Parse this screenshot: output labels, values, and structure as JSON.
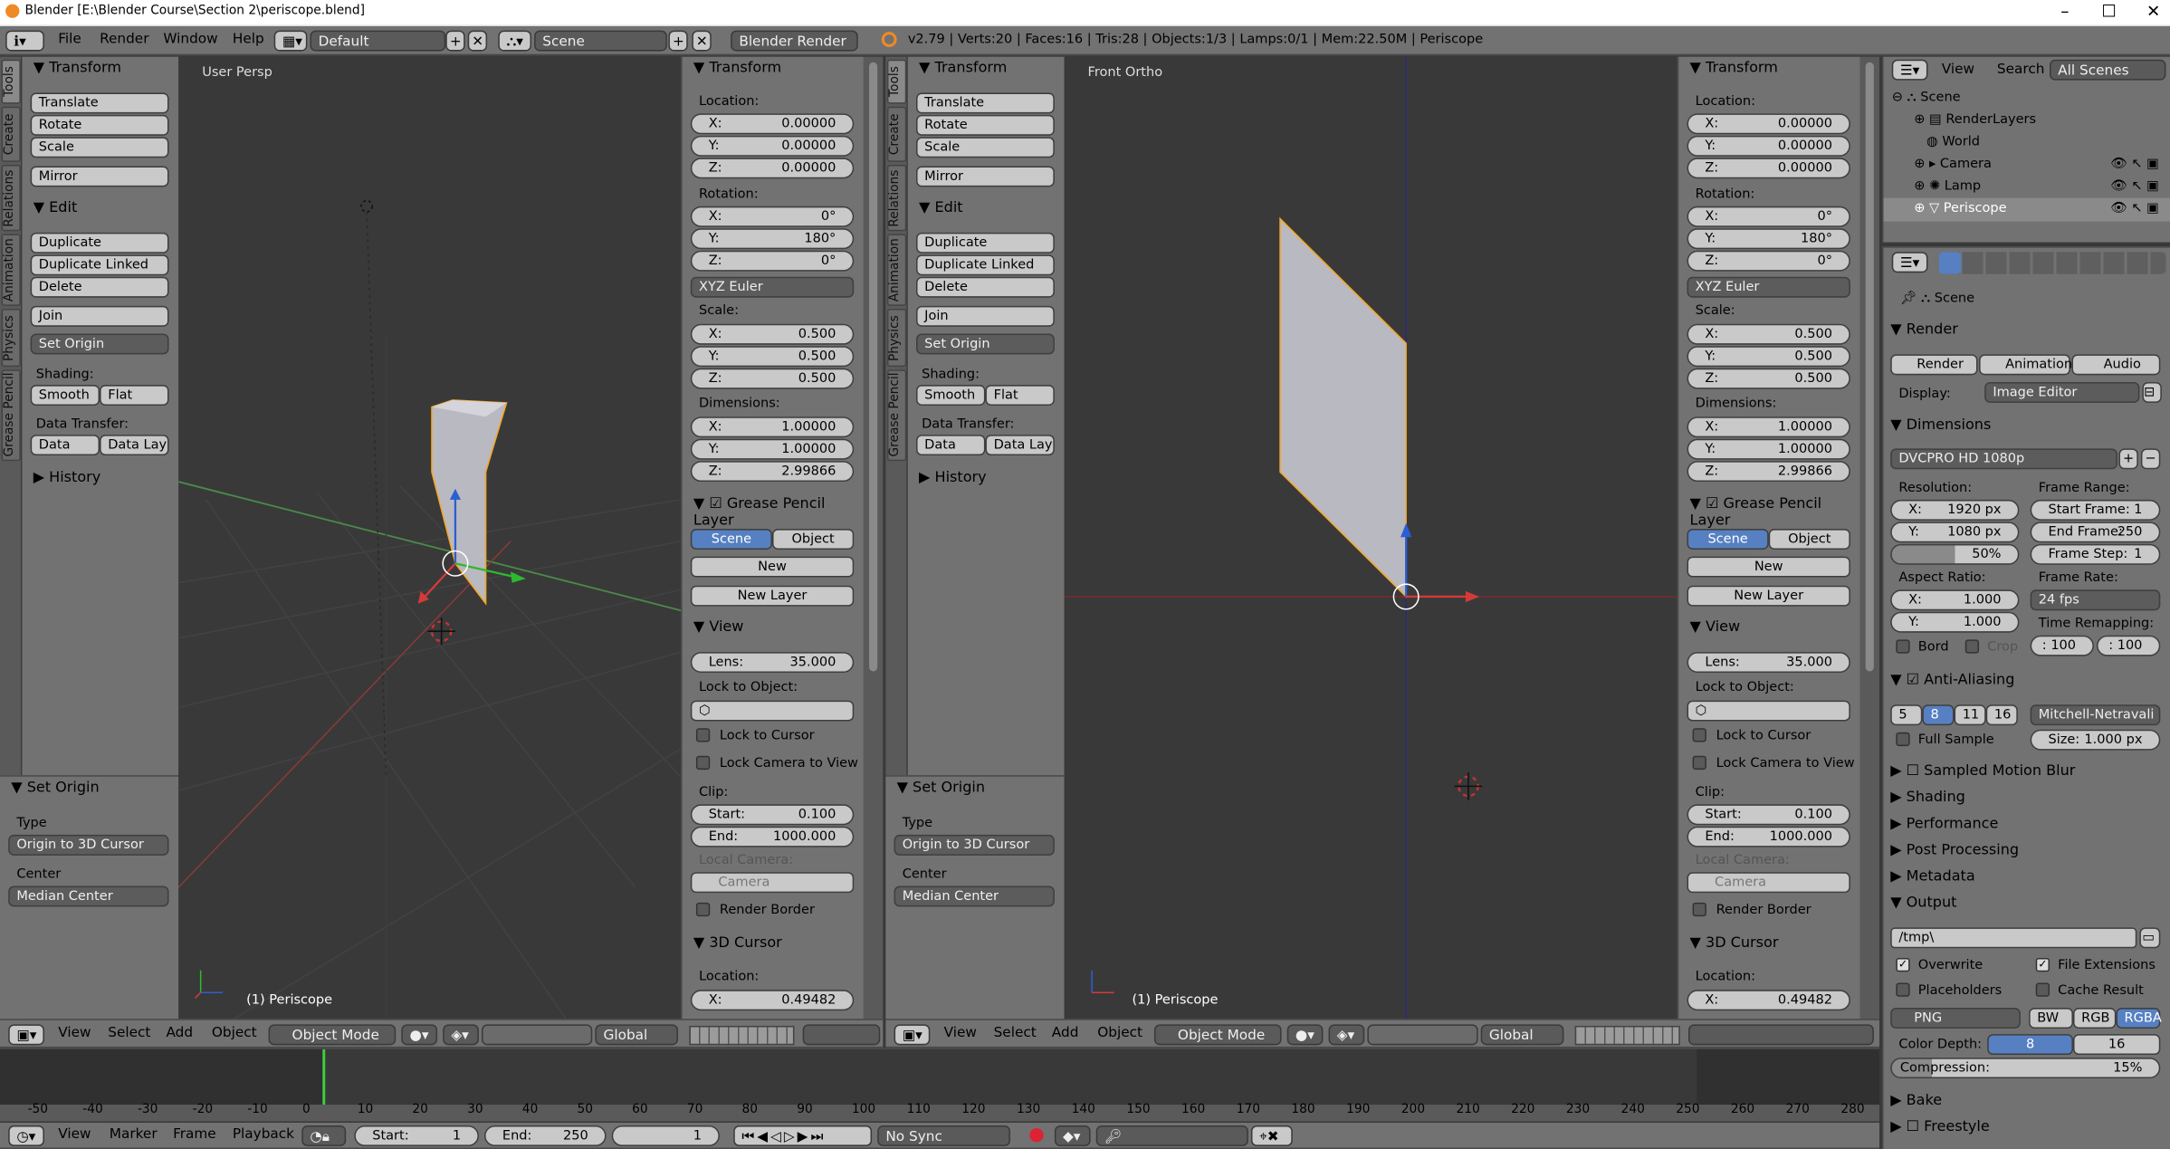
{
  "window": {
    "title": "Blender [E:\\Blender Course\\Section 2\\periscope.blend]",
    "minimize": "–",
    "maximize": "☐",
    "close": "✕"
  },
  "top_bar": {
    "menus": [
      "File",
      "Render",
      "Window",
      "Help"
    ],
    "layout": "Default",
    "scene": "Scene",
    "engine": "Blender Render",
    "stats": "v2.79 | Verts:20 | Faces:16 | Tris:28 | Objects:1/3 | Lamps:0/1 | Mem:22.50M | Periscope"
  },
  "tool_tabs": [
    "Tools",
    "Create",
    "Relations",
    "Animation",
    "Physics",
    "Grease Pencil"
  ],
  "tool_shelf": {
    "transform_header": "Transform",
    "translate": "Translate",
    "rotate": "Rotate",
    "scale": "Scale",
    "mirror": "Mirror",
    "edit_header": "Edit",
    "duplicate": "Duplicate",
    "duplicate_linked": "Duplicate Linked",
    "delete": "Delete",
    "join": "Join",
    "set_origin": "Set Origin",
    "shading_label": "Shading:",
    "smooth": "Smooth",
    "flat": "Flat",
    "data_transfer_label": "Data Transfer:",
    "data": "Data",
    "data_lay": "Data Lay",
    "history": "History"
  },
  "operator_panel": {
    "header": "Set Origin",
    "type_label": "Type",
    "type_value": "Origin to 3D Cursor",
    "center_label": "Center",
    "center_value": "Median Center"
  },
  "viewport_left": {
    "label": "User Persp",
    "object_label": "(1) Periscope"
  },
  "viewport_right": {
    "label": "Front Ortho",
    "object_label": "(1) Periscope"
  },
  "n_panel": {
    "transform": "Transform",
    "location_label": "Location:",
    "loc": [
      "0.00000",
      "0.00000",
      "0.00000"
    ],
    "rotation_label": "Rotation:",
    "rot": [
      "0°",
      "180°",
      "0°"
    ],
    "rot_mode": "XYZ Euler",
    "scale_label": "Scale:",
    "scale": [
      "0.500",
      "0.500",
      "0.500"
    ],
    "dimensions_label": "Dimensions:",
    "dim": [
      "1.00000",
      "1.00000",
      "2.99866"
    ],
    "axes": [
      "X:",
      "Y:",
      "Z:"
    ],
    "gp_layer": "Grease Pencil Layer",
    "scene_btn": "Scene",
    "object_btn": "Object",
    "new_btn": "New",
    "new_layer": "New Layer",
    "view_header": "View",
    "lens_label": "Lens:",
    "lens_value": "35.000",
    "lock_obj_label": "Lock to Object:",
    "lock_cursor": "Lock to Cursor",
    "lock_camera": "Lock Camera to View",
    "clip_label": "Clip:",
    "clip_start_label": "Start:",
    "clip_start": "0.100",
    "clip_end_label": "End:",
    "clip_end": "1000.000",
    "local_camera": "Local Camera:",
    "camera": "Camera",
    "render_border": "Render Border",
    "cursor_header": "3D Cursor",
    "cursor_loc_label": "Location:",
    "cursor_x": "0.49482"
  },
  "viewport_header": {
    "menus": [
      "View",
      "Select",
      "Add",
      "Object"
    ],
    "mode": "Object Mode",
    "orientation": "Global"
  },
  "outliner": {
    "view": "View",
    "search": "Search",
    "filter": "All Scenes",
    "items": [
      "Scene",
      "RenderLayers",
      "World",
      "Camera",
      "Lamp",
      "Periscope"
    ]
  },
  "properties": {
    "scene_label": "Scene",
    "render_header": "Render",
    "render_btn": "Render",
    "animation_btn": "Animation",
    "audio_btn": "Audio",
    "display_label": "Display:",
    "display_value": "Image Editor",
    "dimensions_header": "Dimensions",
    "preset": "DVCPRO HD 1080p",
    "resolution_label": "Resolution:",
    "res_x": "1920 px",
    "res_y": "1080 px",
    "res_pct": "50%",
    "frame_range_label": "Frame Range:",
    "start_frame_label": "Start Frame:",
    "start_frame": "1",
    "end_frame_label": "End Frame:",
    "end_frame": "250",
    "frame_step_label": "Frame Step:",
    "frame_step": "1",
    "aspect_label": "Aspect Ratio:",
    "aspect_x": "1.000",
    "aspect_y": "1.000",
    "frame_rate_label": "Frame Rate:",
    "frame_rate": "24 fps",
    "bord": "Bord",
    "crop": "Crop",
    "time_remap_label": "Time Remapping:",
    "remap_old": ": 100",
    "remap_new": ": 100",
    "aa_header": "Anti-Aliasing",
    "aa_samples": [
      "5",
      "8",
      "11",
      "16"
    ],
    "aa_filter": "Mitchell-Netravali",
    "full_sample": "Full Sample",
    "size_label": "Size:",
    "size_value": "1.000 px",
    "collapsed": [
      "Sampled Motion Blur",
      "Shading",
      "Performance",
      "Post Processing",
      "Metadata"
    ],
    "output_header": "Output",
    "output_path": "/tmp\\",
    "overwrite": "Overwrite",
    "file_ext": "File Extensions",
    "placeholders": "Placeholders",
    "cache_result": "Cache Result",
    "format": "PNG",
    "bw": "BW",
    "rgb": "RGB",
    "rgba": "RGBA",
    "color_depth_label": "Color Depth:",
    "depth_8": "8",
    "depth_16": "16",
    "compression_label": "Compression:",
    "compression_value": "15%",
    "bake": "Bake",
    "freestyle": "Freestyle"
  },
  "timeline": {
    "ticks": [
      "-50",
      "-40",
      "-30",
      "-20",
      "-10",
      "0",
      "10",
      "20",
      "30",
      "40",
      "50",
      "60",
      "70",
      "80",
      "90",
      "100",
      "110",
      "120",
      "130",
      "140",
      "150",
      "160",
      "170",
      "180",
      "190",
      "200",
      "210",
      "220",
      "230",
      "240",
      "250",
      "260",
      "270",
      "280"
    ],
    "menus": [
      "View",
      "Marker",
      "Frame",
      "Playback"
    ],
    "start_label": "Start:",
    "start": "1",
    "end_label": "End:",
    "end": "250",
    "current": "1",
    "sync": "No Sync"
  },
  "colors": {
    "accent": "#5680c2",
    "selection": "#f5a623",
    "bg": "#393939",
    "panel": "#727272"
  }
}
